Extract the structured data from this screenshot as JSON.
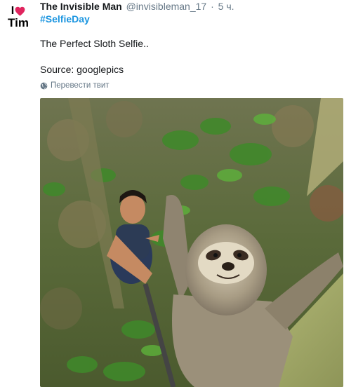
{
  "tweet": {
    "avatar": {
      "line1": "I",
      "line2": "Tim",
      "heart_color": "#e0245e"
    },
    "author_name": "The Invisible Man",
    "handle": "@invisibleman_17",
    "separator": "·",
    "timestamp": "5 ч.",
    "hashtag": "#SelfieDay",
    "text_line1": "The Perfect Sloth Selfie..",
    "text_line2": "Source: googlepics",
    "translate_label": "Перевести твит",
    "photo": {
      "subject": "man and sloth selfie in a forest"
    }
  },
  "colors": {
    "link": "#1b95e0",
    "secondary_text": "#657786",
    "primary_text": "#14171a"
  }
}
